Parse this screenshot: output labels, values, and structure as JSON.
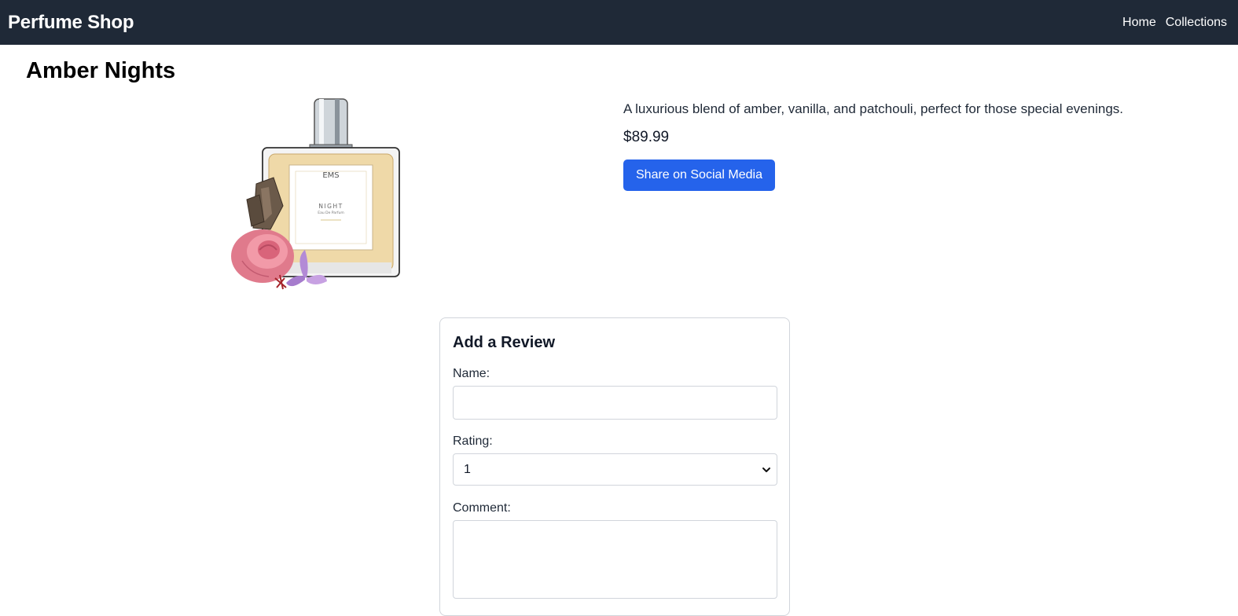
{
  "navbar": {
    "brand": "Perfume Shop",
    "links": [
      {
        "label": "Home"
      },
      {
        "label": "Collections"
      }
    ]
  },
  "product": {
    "title": "Amber Nights",
    "description": "A luxurious blend of amber, vanilla, and patchouli, perfect for those special evenings.",
    "price": "$89.99",
    "share_label": "Share on Social Media",
    "bottle_label": {
      "brand": "EMS",
      "name": "NIGHT",
      "type": "Eau De Parfum"
    }
  },
  "review_form": {
    "heading": "Add a Review",
    "name_label": "Name:",
    "name_value": "",
    "rating_label": "Rating:",
    "rating_value": "1",
    "comment_label": "Comment:"
  },
  "colors": {
    "navbar_bg": "#1f2937",
    "accent": "#2563eb"
  }
}
